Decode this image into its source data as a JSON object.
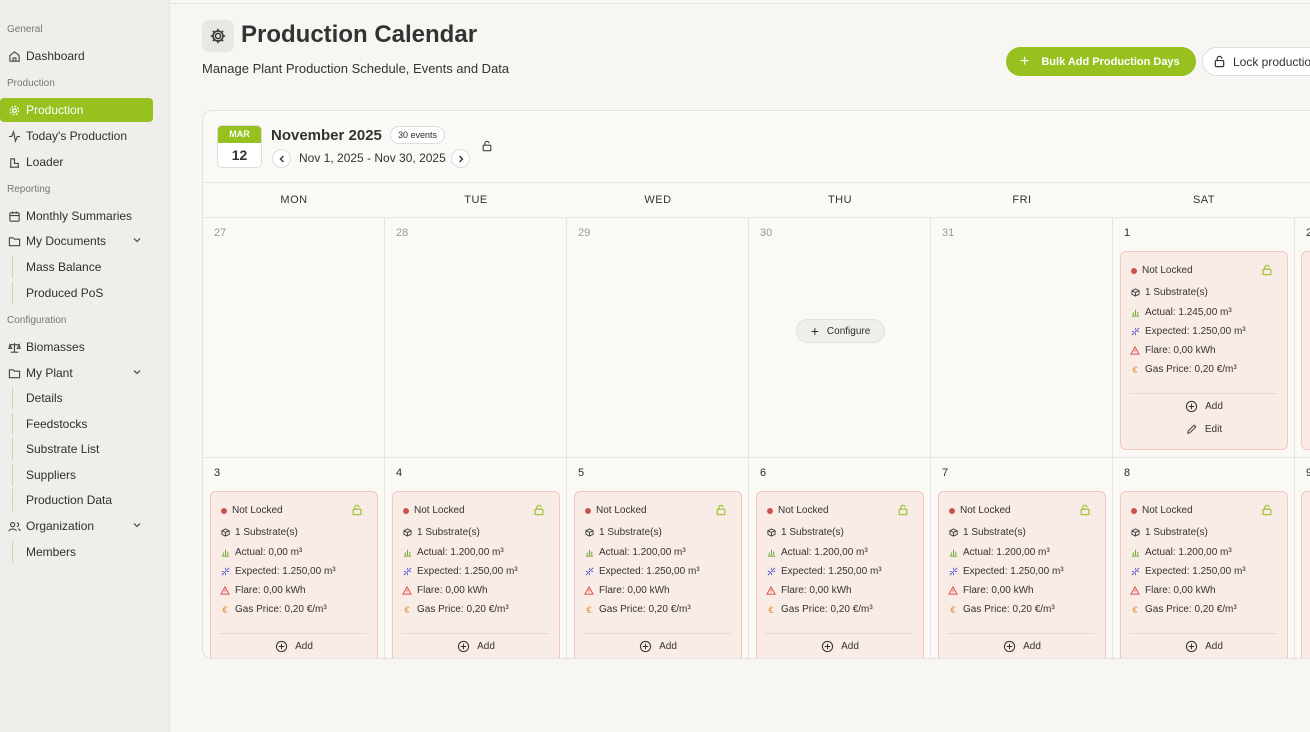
{
  "sidebar": {
    "sections": {
      "general": "General",
      "production": "Production",
      "reporting": "Reporting",
      "configuration": "Configuration"
    },
    "items": {
      "dashboard": "Dashboard",
      "production": "Production",
      "todays_production": "Today's Production",
      "loader": "Loader",
      "monthly_summaries": "Monthly Summaries",
      "my_documents": "My Documents",
      "mass_balance": "Mass Balance",
      "produced_pos": "Produced PoS",
      "biomasses": "Biomasses",
      "my_plant": "My Plant",
      "details": "Details",
      "feedstocks": "Feedstocks",
      "substrate_list": "Substrate List",
      "suppliers": "Suppliers",
      "production_data": "Production Data",
      "organization": "Organization",
      "members": "Members"
    }
  },
  "header": {
    "title": "Production Calendar",
    "subtitle": "Manage Plant Production Schedule, Events and Data",
    "bulk_add_label": "Bulk Add Production Days",
    "lock_label": "Lock productio"
  },
  "calendar": {
    "badge_month": "MAR",
    "badge_day": "12",
    "month_title": "November 2025",
    "events_count": "30 events",
    "range": "Nov 1, 2025 - Nov 30, 2025",
    "weekdays": [
      "MON",
      "TUE",
      "WED",
      "THU",
      "FRI",
      "SAT"
    ],
    "week1_days": [
      "27",
      "28",
      "29",
      "30",
      "31",
      "1",
      "2"
    ],
    "week2_days": [
      "3",
      "4",
      "5",
      "6",
      "7",
      "8",
      "9"
    ],
    "configure_label": "Configure"
  },
  "cards": {
    "sat1": {
      "status": "Not Locked",
      "substrates": "1 Substrate(s)",
      "actual": "Actual: 1.245,00 m³",
      "expected": "Expected: 1.250,00 m³",
      "flare": "Flare: 0,00 kWh",
      "gas_price": "Gas Price: 0,20 €/m³",
      "add": "Add",
      "edit": "Edit"
    },
    "week2": [
      {
        "status": "Not Locked",
        "substrates": "1 Substrate(s)",
        "actual": "Actual: 0,00 m³",
        "expected": "Expected: 1.250,00 m³",
        "flare": "Flare: 0,00 kWh",
        "gas_price": "Gas Price: 0,20 €/m³",
        "add": "Add"
      },
      {
        "status": "Not Locked",
        "substrates": "1 Substrate(s)",
        "actual": "Actual: 1.200,00 m³",
        "expected": "Expected: 1.250,00 m³",
        "flare": "Flare: 0,00 kWh",
        "gas_price": "Gas Price: 0,20 €/m³",
        "add": "Add"
      },
      {
        "status": "Not Locked",
        "substrates": "1 Substrate(s)",
        "actual": "Actual: 1.200,00 m³",
        "expected": "Expected: 1.250,00 m³",
        "flare": "Flare: 0,00 kWh",
        "gas_price": "Gas Price: 0,20 €/m³",
        "add": "Add"
      },
      {
        "status": "Not Locked",
        "substrates": "1 Substrate(s)",
        "actual": "Actual: 1.200,00 m³",
        "expected": "Expected: 1.250,00 m³",
        "flare": "Flare: 0,00 kWh",
        "gas_price": "Gas Price: 0,20 €/m³",
        "add": "Add"
      },
      {
        "status": "Not Locked",
        "substrates": "1 Substrate(s)",
        "actual": "Actual: 1.200,00 m³",
        "expected": "Expected: 1.250,00 m³",
        "flare": "Flare: 0,00 kWh",
        "gas_price": "Gas Price: 0,20 €/m³",
        "add": "Add"
      },
      {
        "status": "Not Locked",
        "substrates": "1 Substrate(s)",
        "actual": "Actual: 1.200,00 m³",
        "expected": "Expected: 1.250,00 m³",
        "flare": "Flare: 0,00 kWh",
        "gas_price": "Gas Price: 0,20 €/m³",
        "add": "Add"
      }
    ]
  },
  "colors": {
    "accent": "#96c11f",
    "card_bg": "#f9ece6",
    "card_border": "#f1c6bc",
    "status_dot": "#c85450",
    "green_icon": "#6da832",
    "blue_icon": "#5b5ed6",
    "warn_icon": "#d9534f",
    "euro_icon": "#e08a2c"
  }
}
